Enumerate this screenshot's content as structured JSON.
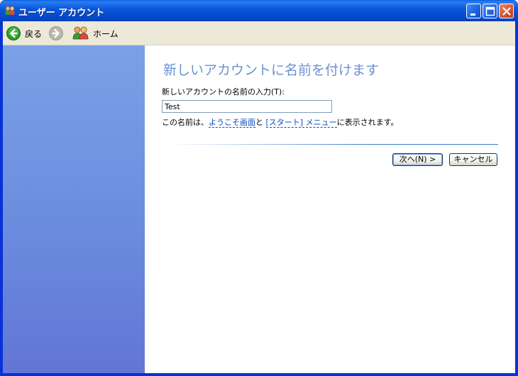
{
  "window": {
    "title": "ユーザー アカウント",
    "controls": {
      "minimize": "minimize",
      "maximize": "maximize",
      "close": "close"
    }
  },
  "toolbar": {
    "back_label": "戻る",
    "home_label": "ホーム"
  },
  "page": {
    "heading": "新しいアカウントに名前を付けます",
    "name_label": "新しいアカウントの名前の入力(T):",
    "name_value": "Test",
    "note_prefix": "この名前は、",
    "note_link1": "ようこそ画面",
    "note_mid": "と ",
    "note_link2": "[スタート] メニュー",
    "note_suffix": "に表示されます。"
  },
  "buttons": {
    "next": "次へ(N) >",
    "cancel": "キャンセル"
  },
  "colors": {
    "title_bar": "#0b58dc",
    "toolbar_bg": "#ece9d8",
    "sidebar": "#6b8fdf",
    "heading": "#6b93cf",
    "link": "#0a4cc5"
  }
}
